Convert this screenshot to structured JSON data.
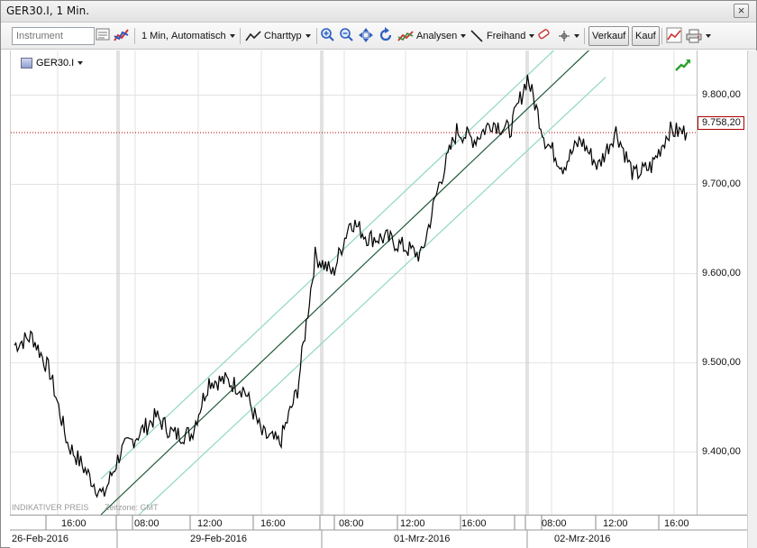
{
  "window": {
    "title": "GER30.I, 1 Min.",
    "close_glyph": "×"
  },
  "toolbar": {
    "instrument_placeholder": "Instrument",
    "interval_label": "1 Min,",
    "mode_label": "Automatisch",
    "charttype_label": "Charttyp",
    "analysis_label": "Analysen",
    "freehand_label": "Freihand",
    "sell_label": "Verkauf",
    "buy_label": "Kauf"
  },
  "chart": {
    "symbol": "GER30.I",
    "current_price_label": "9.758,20",
    "footer_price_type": "INDIKATIVER PREIS",
    "footer_timezone": "Zeitzone: GMT",
    "price_min": 9330,
    "price_max": 9850,
    "current_price": 9758.2,
    "colors": {
      "price_line": "#000000",
      "channel_mid": "#1f5c3a",
      "channel_outer": "#8fd8bd",
      "current_price_line": "#c00000",
      "grid": "#e2e2e2",
      "session_divider": "#c6c6c6"
    },
    "y_ticks": [
      {
        "value": 9800,
        "label": "9.800,00"
      },
      {
        "value": 9700,
        "label": "9.700,00"
      },
      {
        "value": 9600,
        "label": "9.600,00"
      },
      {
        "value": 9500,
        "label": "9.500,00"
      },
      {
        "value": 9400,
        "label": "9.400,00"
      }
    ],
    "x_time_labels": [
      "16:00",
      "08:00",
      "12:00",
      "16:00",
      "08:00",
      "12:00",
      "16:00",
      "08:00",
      "12:00",
      "16:00"
    ],
    "x_date_labels": [
      "26-Feb-2016",
      "29-Feb-2016",
      "01-Mrz-2016",
      "02-Mrz-2016"
    ]
  },
  "chart_data": {
    "type": "line",
    "title": "",
    "xlabel": "",
    "ylabel": "",
    "ylim": [
      9330,
      9850
    ],
    "grid": true,
    "x": [
      "26-Feb 15:00",
      "26-Feb 16:00",
      "26-Feb 17:00",
      "29-Feb 08:00",
      "29-Feb 09:00",
      "29-Feb 10:00",
      "29-Feb 11:00",
      "29-Feb 12:00",
      "29-Feb 13:00",
      "29-Feb 14:00",
      "29-Feb 15:00",
      "29-Feb 16:00",
      "29-Feb 17:00",
      "29-Feb 18:00",
      "29-Feb 19:00",
      "29-Feb 20:00",
      "01-Mrz 08:00",
      "01-Mrz 09:00",
      "01-Mrz 10:00",
      "01-Mrz 11:00",
      "01-Mrz 12:00",
      "01-Mrz 13:00",
      "01-Mrz 14:00",
      "01-Mrz 15:00",
      "01-Mrz 16:00",
      "01-Mrz 17:00",
      "01-Mrz 18:00",
      "01-Mrz 19:00",
      "01-Mrz 20:00",
      "02-Mrz 08:00",
      "02-Mrz 09:00",
      "02-Mrz 10:00",
      "02-Mrz 11:00",
      "02-Mrz 12:00",
      "02-Mrz 13:00",
      "02-Mrz 14:00",
      "02-Mrz 15:00",
      "02-Mrz 16:00",
      "02-Mrz 17:00"
    ],
    "series": [
      {
        "values": [
          9520,
          9530,
          9490,
          9410,
          9380,
          9350,
          9400,
          9420,
          9440,
          9420,
          9420,
          9480,
          9480,
          9470,
          9420,
          9410,
          9470,
          9620,
          9600,
          9660,
          9640,
          9640,
          9630,
          9620,
          9700,
          9760,
          9750,
          9770,
          9760,
          9820,
          9750,
          9720,
          9750,
          9720,
          9760,
          9710,
          9720,
          9760,
          9758
        ]
      }
    ]
  }
}
